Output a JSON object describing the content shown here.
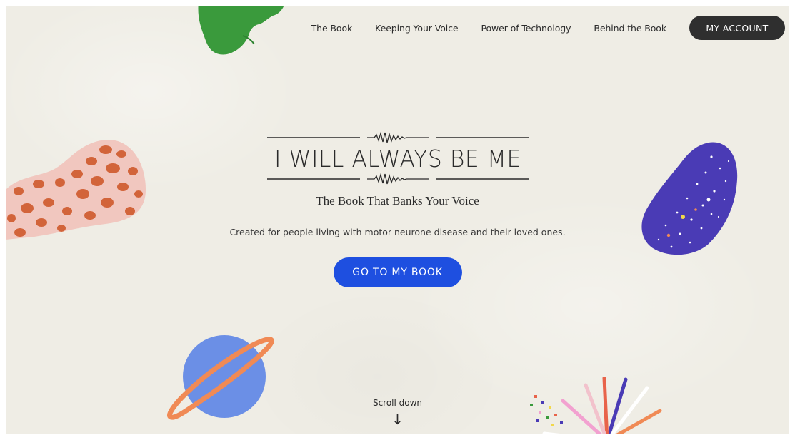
{
  "nav": {
    "links": [
      "The Book",
      "Keeping Your Voice",
      "Power of Technology",
      "Behind the Book"
    ],
    "account_label": "MY ACCOUNT"
  },
  "hero": {
    "title": "I WILL ALWAYS BE ME",
    "subtitle": "The Book That Banks Your Voice",
    "description": "Created for people living with motor neurone disease and their loved ones.",
    "cta_label": "GO TO MY BOOK"
  },
  "scroll": {
    "label": "Scroll down",
    "arrow": "↓"
  },
  "decorations": [
    "green-leaf-shape",
    "orange-spotted-blob",
    "purple-starry-blob",
    "blue-planet-with-ring",
    "starburst-lines"
  ],
  "colors": {
    "background": "#efede5",
    "cta_blue": "#1e4fe0",
    "account_dark": "#2f2f2f",
    "leaf_green": "#3a9a3c",
    "blob_orange": "#d2643a",
    "blob_pink": "#f1c7bf",
    "blob_purple": "#4a3bb5",
    "planet_blue": "#6b8fe6",
    "ring_orange": "#f08a55"
  }
}
